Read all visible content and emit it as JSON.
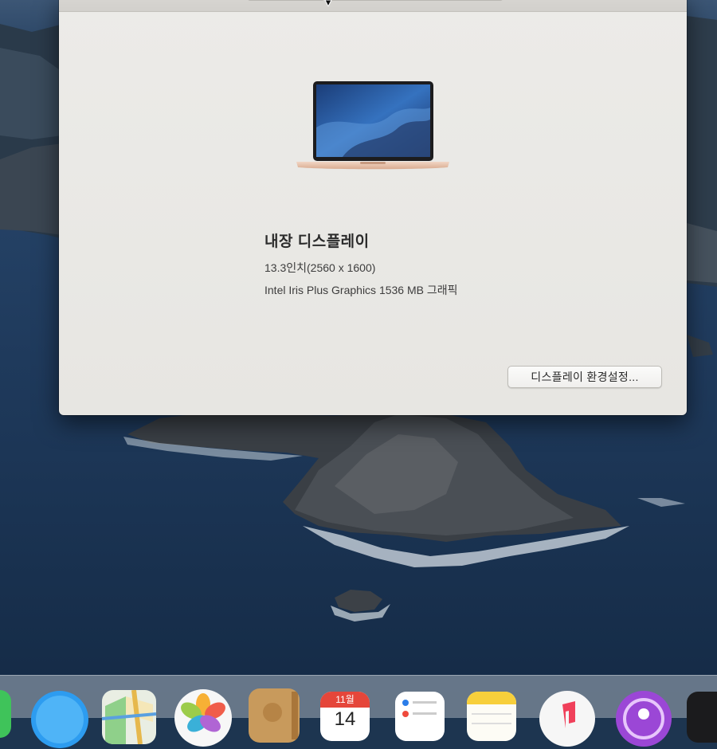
{
  "window": {
    "display_name": "내장 디스플레이",
    "display_size": "13.3인치(2560 x 1600)",
    "graphics": "Intel Iris Plus Graphics 1536 MB 그래픽",
    "preferences_button": "디스플레이 환경설정..."
  },
  "dock": {
    "items": [
      {
        "icon": "messages-icon"
      },
      {
        "icon": "safari-icon"
      },
      {
        "icon": "maps-icon"
      },
      {
        "icon": "photos-icon"
      },
      {
        "icon": "contacts-icon"
      },
      {
        "icon": "calendar-icon",
        "month": "11월",
        "day": "14"
      },
      {
        "icon": "reminders-icon"
      },
      {
        "icon": "notes-icon"
      },
      {
        "icon": "music-icon"
      },
      {
        "icon": "podcasts-icon"
      },
      {
        "icon": "tv-icon"
      }
    ]
  },
  "colors": {
    "window_bg": "#e9e8e5",
    "wallpaper_sea": "#1d3550",
    "screen_blue": "#2a5fa8",
    "laptop_gold": "#e6c2ac"
  }
}
